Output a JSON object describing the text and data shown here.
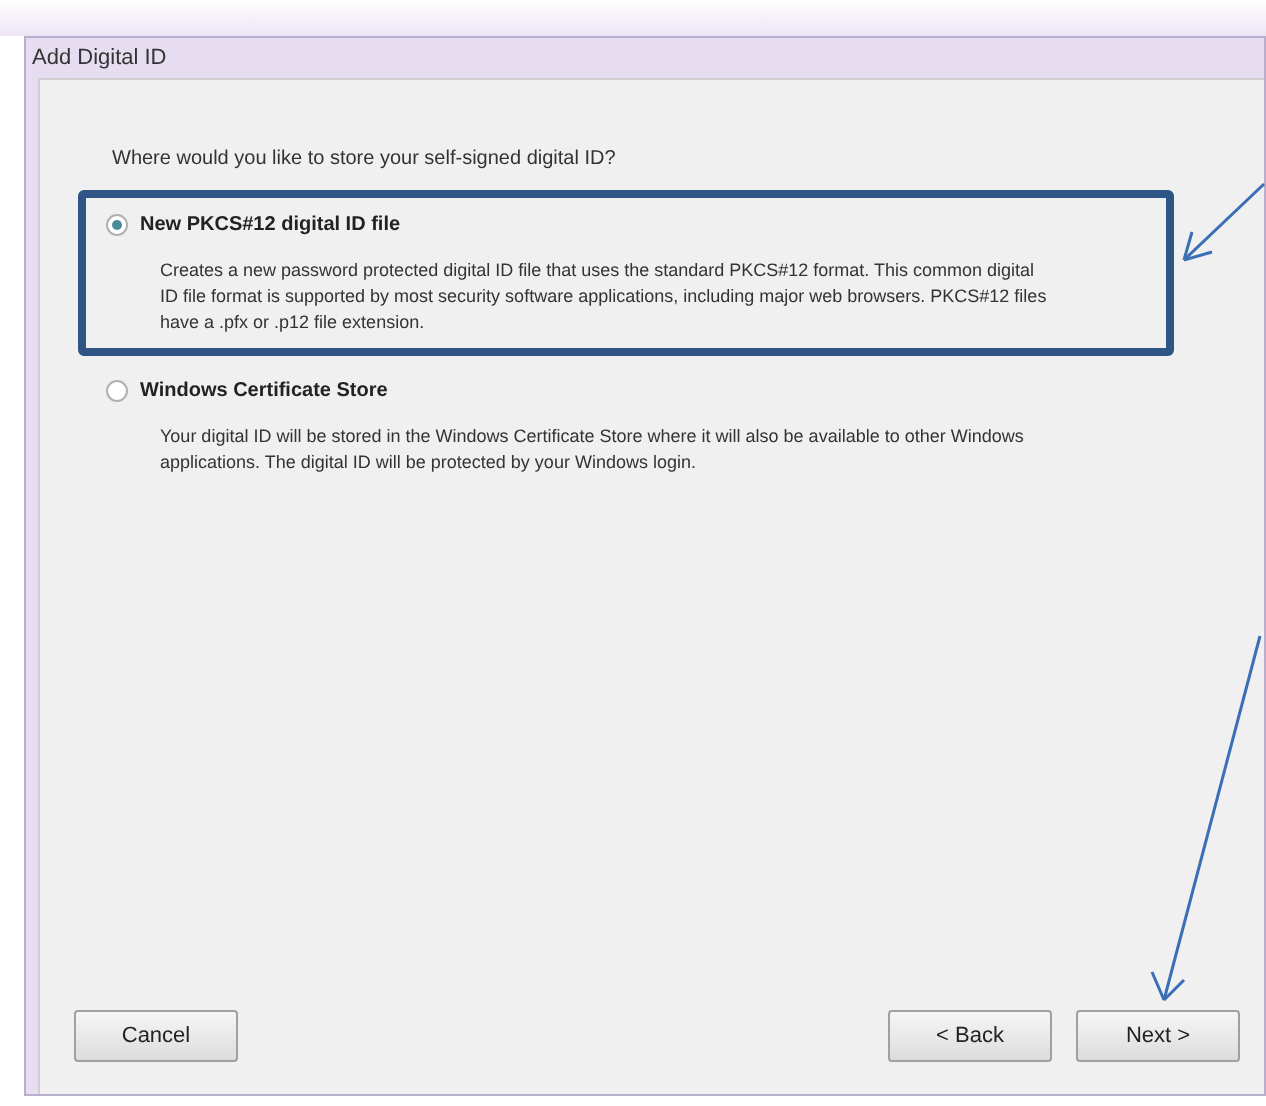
{
  "window": {
    "title": "Add Digital ID"
  },
  "question": "Where would you like to store your self-signed digital ID?",
  "options": [
    {
      "label": "New PKCS#12 digital ID file",
      "selected": true,
      "highlighted": true,
      "description": "Creates a new password protected digital ID file that uses the standard PKCS#12 format. This common digital ID file format is supported by most security software applications, including major web browsers. PKCS#12 files have a .pfx or .p12 file extension."
    },
    {
      "label": "Windows Certificate Store",
      "selected": false,
      "highlighted": false,
      "description": "Your digital ID will be stored in the Windows Certificate Store where it will also be available to other Windows applications. The digital ID will be protected by your Windows login."
    }
  ],
  "buttons": {
    "cancel": "Cancel",
    "back": "< Back",
    "next": "Next >"
  }
}
